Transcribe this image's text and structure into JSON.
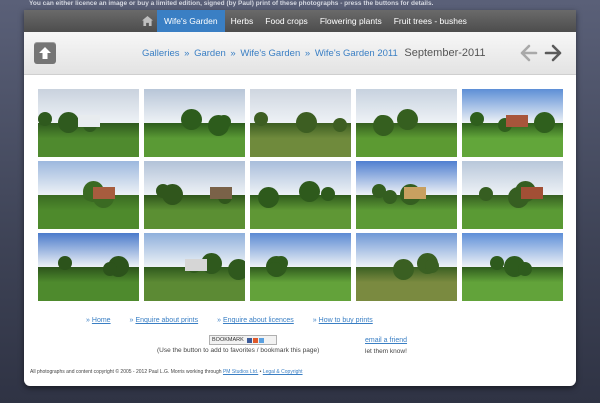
{
  "notice": "You can either licence an image or buy a limited edition, signed (by Paul) print of these photographs - press the buttons for details.",
  "nav": {
    "items": [
      {
        "label": "Wife's Garden",
        "active": true
      },
      {
        "label": "Herbs",
        "active": false
      },
      {
        "label": "Food crops",
        "active": false
      },
      {
        "label": "Flowering plants",
        "active": false
      },
      {
        "label": "Fruit trees - bushes",
        "active": false
      }
    ]
  },
  "breadcrumb": {
    "links": [
      "Galleries",
      "Garden",
      "Wife's Garden",
      "Wife's Garden 2011"
    ],
    "separator": "»",
    "current": "September-2011"
  },
  "thumbnails": [
    {
      "sky": "#c9d2de",
      "ground": "#4f8a2e",
      "accent": "#2f5a1e",
      "house": "#e8ecef"
    },
    {
      "sky": "#b8c6d8",
      "ground": "#5a9a35",
      "accent": "#2d5c1c",
      "house": ""
    },
    {
      "sky": "#cfd6e0",
      "ground": "#6f8a3c",
      "accent": "#3d5e22",
      "house": ""
    },
    {
      "sky": "#c7d2df",
      "ground": "#5c9a32",
      "accent": "#355f1f",
      "house": ""
    },
    {
      "sky": "#5d8fd6",
      "ground": "#62a63a",
      "accent": "#2f5f1d",
      "house": "#a8553b"
    },
    {
      "sky": "#9db8de",
      "ground": "#4e8a2c",
      "accent": "#3a6a22",
      "house": "#a75c3e"
    },
    {
      "sky": "#b2c2d8",
      "ground": "#5b8f33",
      "accent": "#30561c",
      "house": "#7a6248"
    },
    {
      "sky": "#a8bddb",
      "ground": "#5f9735",
      "accent": "#2e5a1c",
      "house": ""
    },
    {
      "sky": "#4f7fd0",
      "ground": "#5c9a35",
      "accent": "#345e20",
      "house": "#c8a060"
    },
    {
      "sky": "#b8c7da",
      "ground": "#5a9a34",
      "accent": "#365e21",
      "house": "#a24f35"
    },
    {
      "sky": "#4b7bcb",
      "ground": "#4e8a2d",
      "accent": "#2c531b",
      "house": ""
    },
    {
      "sky": "#8fb0dc",
      "ground": "#5c8a34",
      "accent": "#2f591d",
      "house": "#d6d6d6"
    },
    {
      "sky": "#5b8ad3",
      "ground": "#63a23a",
      "accent": "#2f5a1d",
      "house": ""
    },
    {
      "sky": "#6f98d6",
      "ground": "#7a8a40",
      "accent": "#3a5f22",
      "house": ""
    },
    {
      "sky": "#5e8fd8",
      "ground": "#62a33a",
      "accent": "#2e5b1d",
      "house": ""
    }
  ],
  "footer": {
    "links": [
      "Home",
      "Enquire about prints",
      "Enquire about licences",
      "How to buy prints"
    ],
    "bookmark_label": "BOOKMARK",
    "bookmark_hint": "(Use the button to add to favorites / bookmark this page)",
    "email_label": "email a friend",
    "email_hint": "let them know!",
    "copyright_text": "All photographs and content copyright © 2005 - 2012 Paul L.G. Morris working through",
    "studio_link": "PM Studios Ltd.",
    "legal_link": "Legal & Copyright"
  },
  "colors": {
    "accent": "#3a7fc4",
    "navbar": "#555555"
  },
  "icons": {
    "home": "home-icon",
    "up": "up-arrow-icon",
    "prev": "prev-arrow-icon",
    "next": "next-arrow-icon"
  }
}
